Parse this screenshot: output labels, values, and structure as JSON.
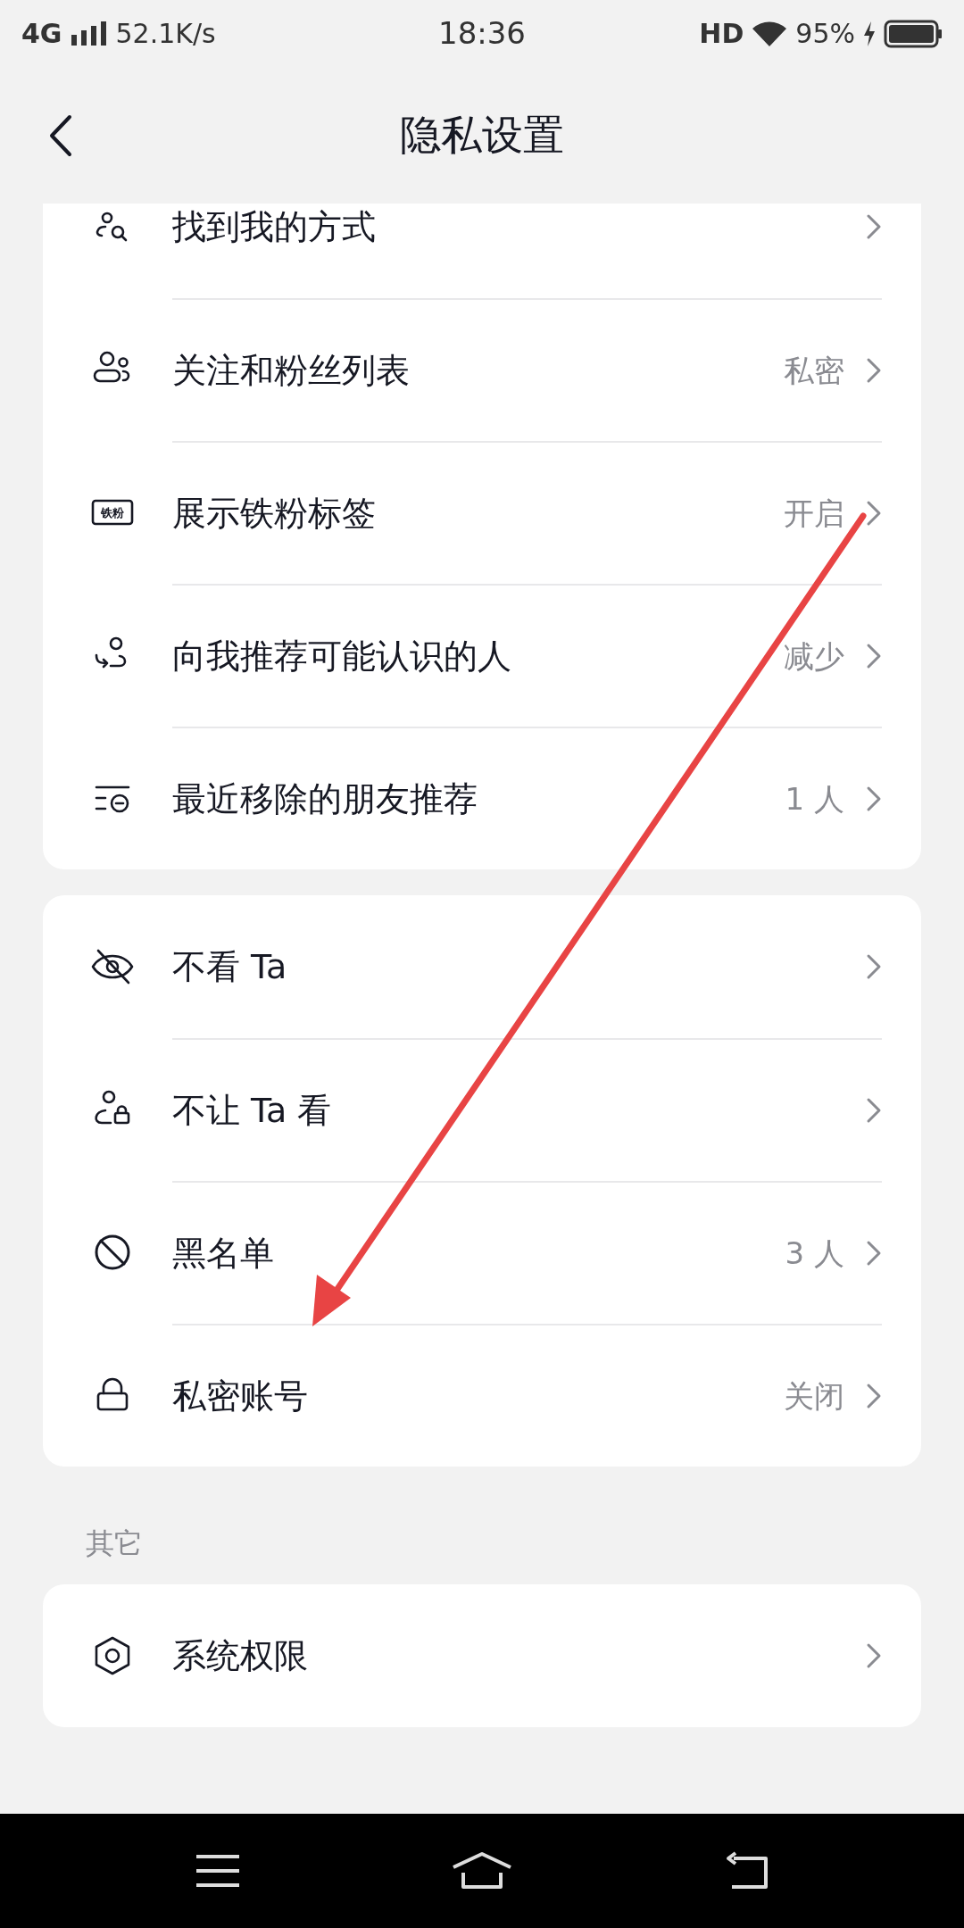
{
  "status_bar": {
    "network": "4G",
    "speed": "52.1K/s",
    "time": "18:36",
    "hd": "HD",
    "battery": "95%"
  },
  "header": {
    "title": "隐私设置"
  },
  "cards": [
    {
      "items": [
        {
          "label": "找到我的方式"
        },
        {
          "label": "关注和粉丝列表",
          "value": "私密"
        },
        {
          "label": "展示铁粉标签",
          "value": "开启"
        },
        {
          "label": "向我推荐可能认识的人",
          "value": "减少"
        },
        {
          "label": "最近移除的朋友推荐",
          "value": "1 人"
        }
      ]
    },
    {
      "items": [
        {
          "label": "不看 Ta"
        },
        {
          "label": "不让 Ta 看"
        },
        {
          "label": "黑名单",
          "value": "3 人"
        },
        {
          "label": "私密账号",
          "value": "关闭"
        }
      ]
    },
    {
      "section": "其它",
      "items": [
        {
          "label": "系统权限"
        }
      ]
    }
  ],
  "badge_icon_text": "铁粉"
}
